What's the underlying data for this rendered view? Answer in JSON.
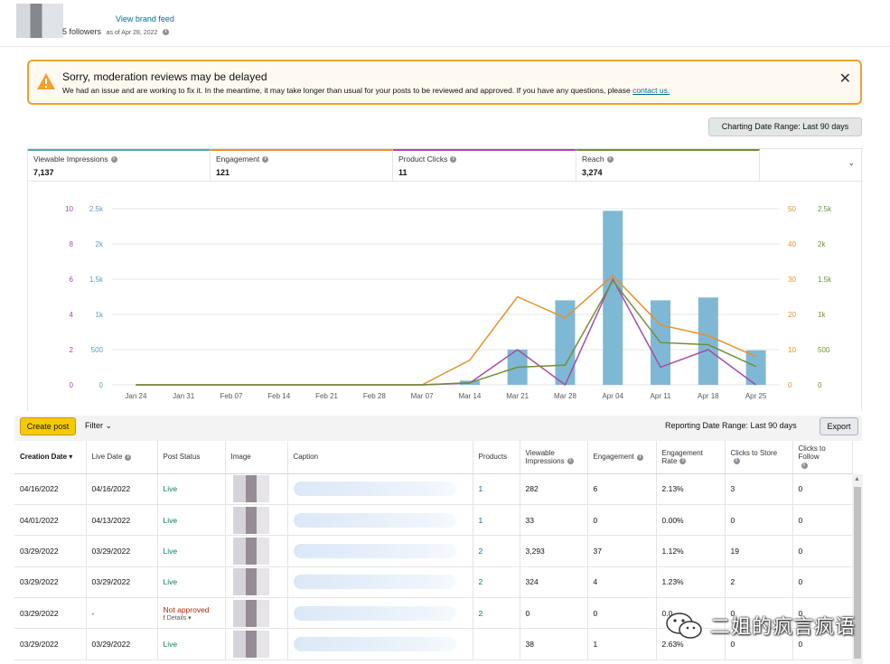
{
  "header": {
    "brand_link": "View brand feed",
    "followers": "5 followers",
    "as_of": "as of Apr 28, 2022"
  },
  "alert": {
    "title": "Sorry, moderation reviews may be delayed",
    "body": "We had an issue and are working to fix it. In the meantime, it may take longer than usual for your posts to be reviewed and approved. If you have any questions, please",
    "link": "contact us.",
    "accent_color": "#f0a030"
  },
  "charting_range": "Charting Date Range: Last 90 days",
  "metrics": [
    {
      "label": "Viewable Impressions",
      "value": "7,137",
      "color": "#5a9fb7"
    },
    {
      "label": "Engagement",
      "value": "121",
      "color": "#e8912d"
    },
    {
      "label": "Product Clicks",
      "value": "11",
      "color": "#a64ca6"
    },
    {
      "label": "Reach",
      "value": "3,274",
      "color": "#6f8f3a"
    }
  ],
  "chart_data": {
    "type": "bar",
    "categories": [
      "Jan 24",
      "Jan 31",
      "Feb 07",
      "Feb 14",
      "Feb 21",
      "Feb 28",
      "Mar 07",
      "Mar 14",
      "Mar 21",
      "Mar 28",
      "Apr 04",
      "Apr 11",
      "Apr 18",
      "Apr 25"
    ],
    "left_axis_clicks": {
      "ticks": [
        "10",
        "8",
        "6",
        "4",
        "2",
        "0"
      ],
      "color": "#a64ca6",
      "ylim": [
        0,
        10
      ]
    },
    "left_axis_impressions": {
      "ticks": [
        "2.5k",
        "2k",
        "1.5k",
        "1k",
        "500",
        "0"
      ],
      "color": "#5a9fb7",
      "ylim": [
        0,
        2500
      ]
    },
    "right_axis_engagement": {
      "ticks": [
        "50",
        "40",
        "30",
        "20",
        "10",
        "0"
      ],
      "color": "#e8912d",
      "ylim": [
        0,
        50
      ]
    },
    "right_axis_reach": {
      "ticks": [
        "2.5k",
        "2k",
        "1.5k",
        "1k",
        "500",
        "0"
      ],
      "color": "#6f8f3a",
      "ylim": [
        0,
        2500
      ]
    },
    "series": [
      {
        "name": "Viewable Impressions",
        "kind": "bar",
        "axis": "impressions",
        "color": "#7fb8d4",
        "values": [
          0,
          0,
          0,
          0,
          0,
          0,
          0,
          60,
          500,
          1200,
          2470,
          1200,
          1240,
          490
        ]
      },
      {
        "name": "Engagement",
        "kind": "line",
        "axis": "engagement",
        "color": "#e8912d",
        "values": [
          0,
          0,
          0,
          0,
          0,
          0,
          0,
          7,
          25,
          19,
          31,
          17,
          14,
          8
        ]
      },
      {
        "name": "Product Clicks",
        "kind": "line",
        "axis": "clicks",
        "color": "#a64ca6",
        "values": [
          0,
          0,
          0,
          0,
          0,
          0,
          0,
          0.1,
          2,
          0,
          6,
          1,
          2,
          0
        ]
      },
      {
        "name": "Reach",
        "kind": "line",
        "axis": "reach",
        "color": "#6f8f3a",
        "values": [
          0,
          0,
          0,
          0,
          0,
          0,
          0,
          30,
          250,
          280,
          1480,
          600,
          570,
          260
        ]
      }
    ],
    "grid": true
  },
  "toolbar": {
    "create_post": "Create post",
    "filter": "Filter",
    "reporting_range": "Reporting Date Range: Last 90 days",
    "export": "Export"
  },
  "table": {
    "headers": [
      "Creation Date",
      "Live Date",
      "Post Status",
      "Image",
      "Caption",
      "Products",
      "Viewable Impressions",
      "Engagement",
      "Engagement Rate",
      "Clicks to Store",
      "Clicks to Follow"
    ],
    "rows": [
      {
        "creation": "04/16/2022",
        "live": "04/16/2022",
        "status": "Live",
        "products": "1",
        "impressions": "282",
        "engagement": "6",
        "rate": "2.13%",
        "store": "3",
        "follow": "0"
      },
      {
        "creation": "04/01/2022",
        "live": "04/13/2022",
        "status": "Live",
        "products": "1",
        "impressions": "33",
        "engagement": "0",
        "rate": "0.00%",
        "store": "0",
        "follow": "0"
      },
      {
        "creation": "03/29/2022",
        "live": "03/29/2022",
        "status": "Live",
        "products": "2",
        "impressions": "3,293",
        "engagement": "37",
        "rate": "1.12%",
        "store": "19",
        "follow": "0"
      },
      {
        "creation": "03/29/2022",
        "live": "03/29/2022",
        "status": "Live",
        "products": "2",
        "impressions": "324",
        "engagement": "4",
        "rate": "1.23%",
        "store": "2",
        "follow": "0"
      },
      {
        "creation": "03/29/2022",
        "live": "-",
        "status": "Not approved",
        "details": "Details",
        "products": "2",
        "impressions": "0",
        "engagement": "0",
        "rate": "0.0",
        "store": "0",
        "follow": "0"
      },
      {
        "creation": "03/29/2022",
        "live": "03/29/2022",
        "status": "Live",
        "products": "",
        "impressions": "38",
        "engagement": "1",
        "rate": "2.63%",
        "store": "0",
        "follow": "0"
      }
    ]
  },
  "watermark": "二姐的疯言疯语"
}
